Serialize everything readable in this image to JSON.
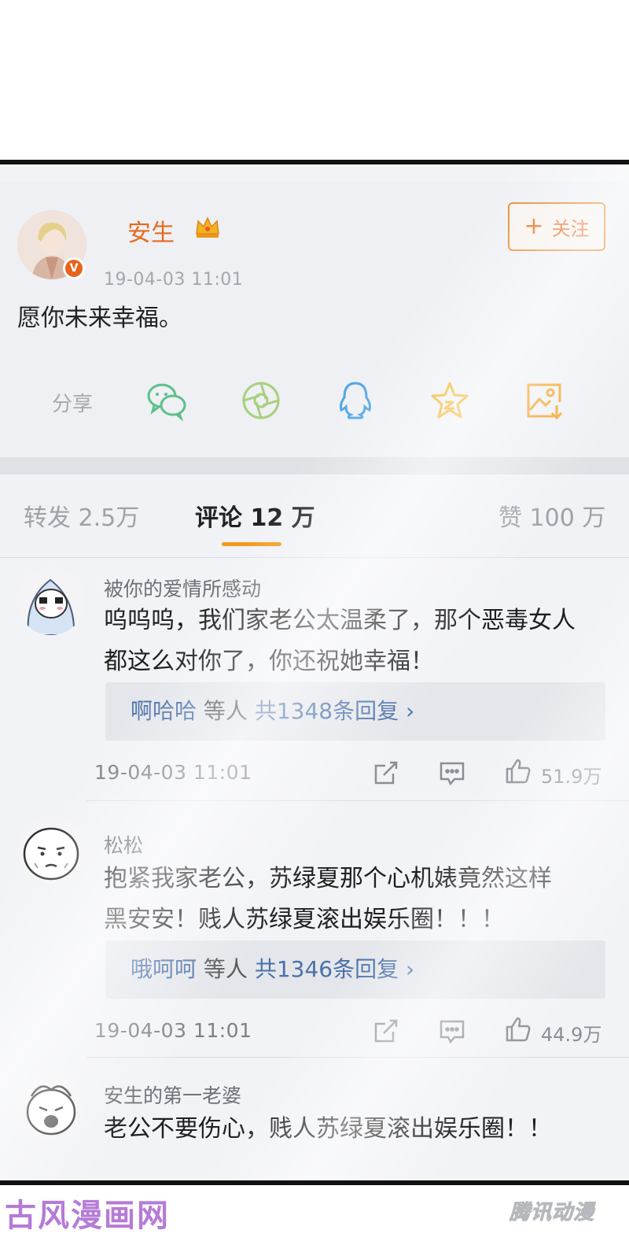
{
  "post": {
    "author": "安生",
    "time": "19-04-03  11:01",
    "follow_label": "关注",
    "text": "愿你未来幸福。",
    "share_label": "分享",
    "share_icons": [
      "wechat-icon",
      "moments-icon",
      "qq-icon",
      "favorite-star-icon",
      "save-image-icon"
    ],
    "author_color": "#e86a1e"
  },
  "tabs": {
    "repost": "转发 2.5万",
    "comment": "评论 12 万",
    "like": "赞 100 万",
    "accent": "#f29a1e"
  },
  "comments": [
    {
      "name": "被你的爱情所感动",
      "text_lines": [
        "呜呜呜，我们家老公太温柔了，那个恶毒女人",
        "都这么对你了，你还祝她幸福！"
      ],
      "reply_user": "啊哈哈",
      "reply_mid": " 等人 ",
      "reply_count": "共1348条回复 ›",
      "time": "19-04-03  11:01",
      "likes": "51.9万"
    },
    {
      "name": "松松",
      "text_lines": [
        "抱紧我家老公，苏绿夏那个心机婊竟然这样",
        "黑安安！贱人苏绿夏滚出娱乐圈！！！"
      ],
      "reply_user": "哦呵呵",
      "reply_mid": " 等人 ",
      "reply_count": "共1346条回复 ›",
      "time": "19-04-03  11:01",
      "likes": "44.9万"
    },
    {
      "name": "安生的第一老婆",
      "text_lines": [
        "老公不要伤心，贱人苏绿夏滚出娱乐圈！！"
      ]
    }
  ],
  "watermarks": {
    "left": "古风漫画网",
    "right": "腾讯动漫"
  }
}
